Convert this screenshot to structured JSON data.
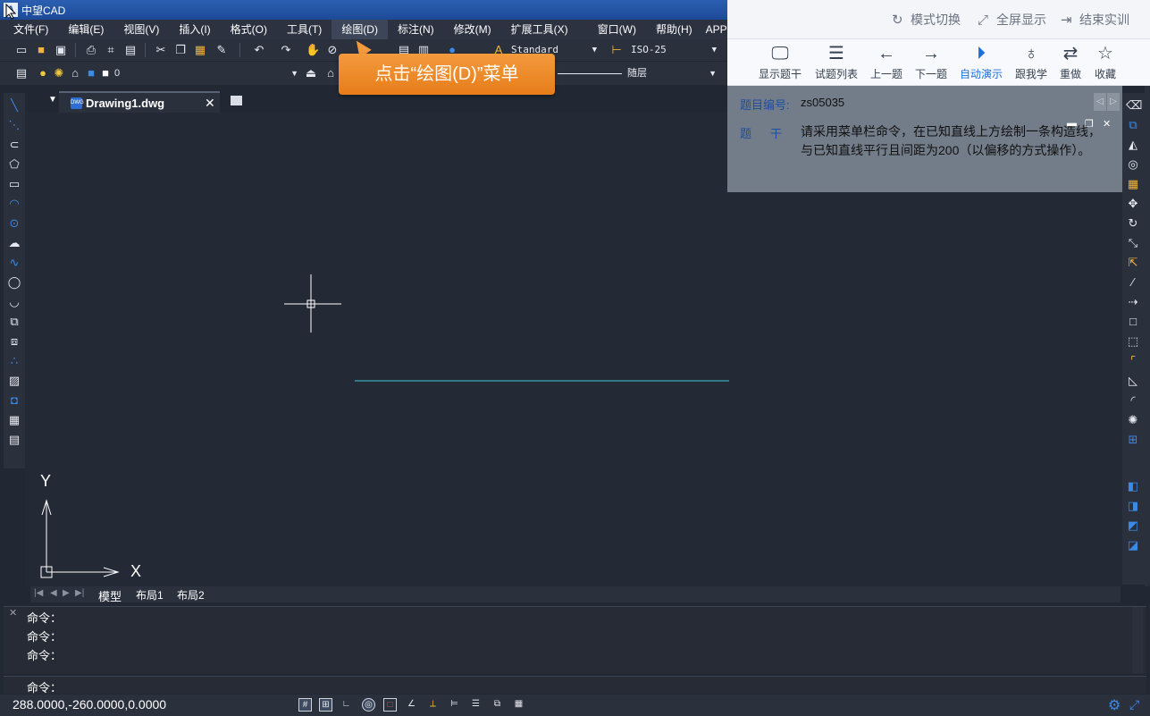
{
  "app": {
    "title": "中望CAD",
    "logo": "A"
  },
  "menu": [
    "文件(F)",
    "编辑(E)",
    "视图(V)",
    "插入(I)",
    "格式(O)",
    "工具(T)",
    "绘图(D)",
    "标注(N)",
    "修改(M)",
    "扩展工具(X)",
    "窗口(W)",
    "帮助(H)",
    "APP+"
  ],
  "toolbar": {
    "text_style": "Standard",
    "dim_style": "ISO-25",
    "layer": "0",
    "linetype": "随层"
  },
  "top_actions": {
    "switch_mode": "模式切换",
    "fullscreen": "全屏显示",
    "end_training": "结束实训"
  },
  "nav": {
    "show_stem": "显示题干",
    "question_list": "试题列表",
    "prev": "上一题",
    "next": "下一题",
    "auto_demo": "自动演示",
    "follow": "跟我学",
    "redo": "重做",
    "favorite": "收藏"
  },
  "question": {
    "id_label": "题目编号:",
    "id": "zs05035",
    "stem_label": "题干:",
    "stem": "请采用菜单栏命令，在已知直线上方绘制一条构造线，与已知直线平行且间距为200（以偏移的方式操作）。"
  },
  "callout": "点击“绘图(D)”菜单",
  "tabs": {
    "document": "Drawing1.dwg"
  },
  "layout_tabs": [
    "模型",
    "布局1",
    "布局2"
  ],
  "ucs": {
    "x": "X",
    "y": "Y"
  },
  "command": {
    "history": [
      "命令：",
      "命令：",
      "命令："
    ],
    "prompt": "命令："
  },
  "status": {
    "coords": "288.0000,-260.0000,0.0000"
  },
  "colors": {
    "accent": "#1e6fd9",
    "callout": "#ef8a2b",
    "line": "#3fc8d8",
    "canvas": "#242a35"
  },
  "icons": {
    "status_bar": [
      "grid-icon",
      "snap-icon",
      "ortho-icon",
      "polar-icon",
      "osnap-icon",
      "otrack-icon",
      "ducs-icon",
      "dyn-icon",
      "lineweight-icon",
      "tpy-icon",
      "qp-icon"
    ]
  }
}
